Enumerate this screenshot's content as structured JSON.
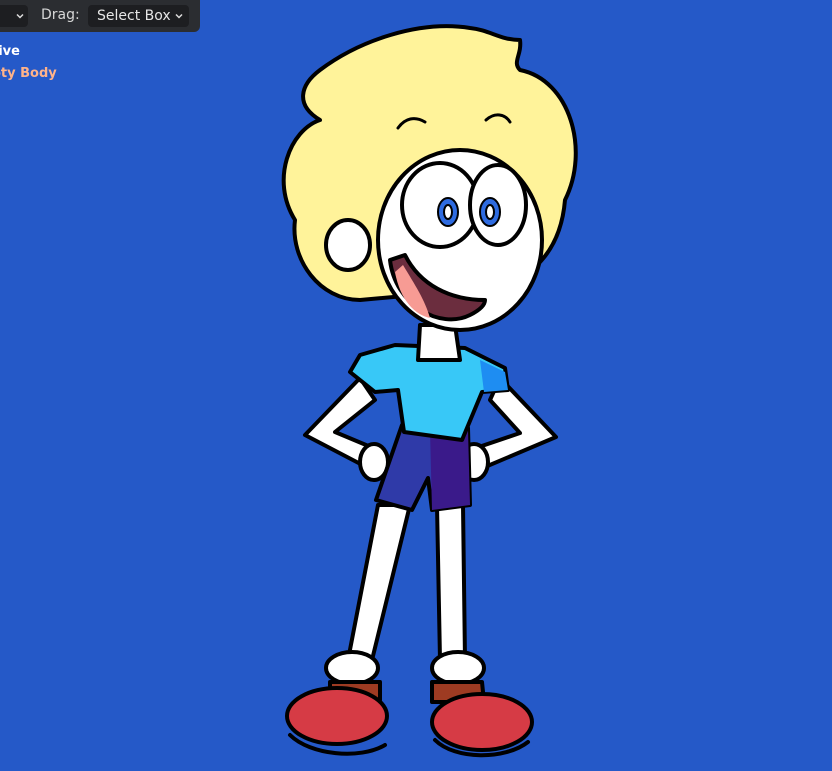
{
  "header": {
    "drag_label": "Drag:",
    "select_mode": "Select Box"
  },
  "overlay": {
    "line1": "tive",
    "line2": "oty Body"
  },
  "colors": {
    "background": "#2559c8",
    "hair": "#fff39a",
    "shirt": "#38c8f7",
    "shorts": "#2f3aa8",
    "shoes": "#d63b45"
  }
}
